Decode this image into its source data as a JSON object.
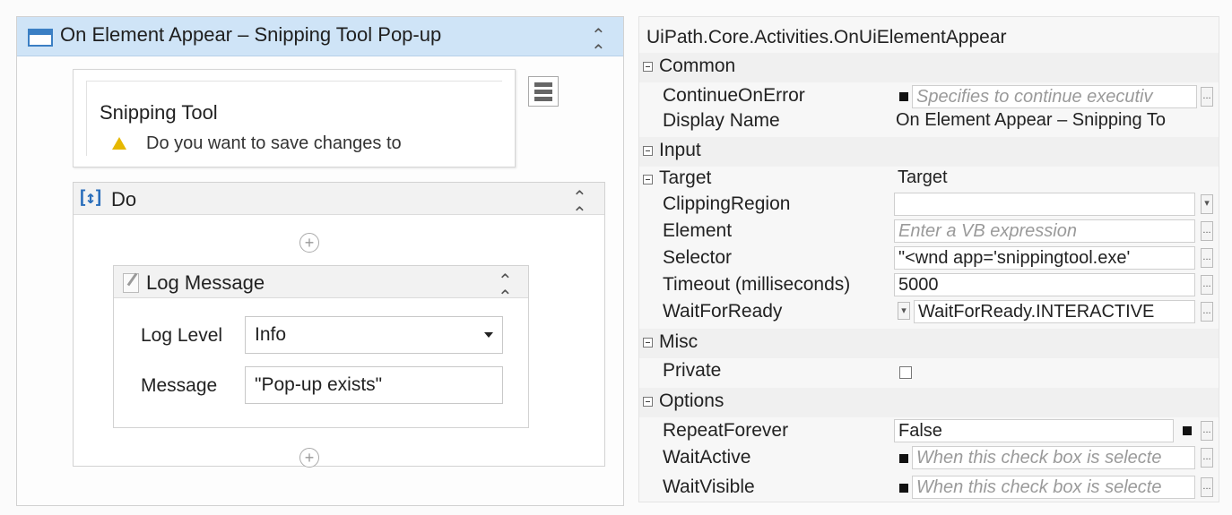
{
  "designer": {
    "activity_title": "On Element Appear – Snipping Tool Pop-up",
    "target_preview": {
      "title": "Snipping Tool",
      "clipped_text": "Do you want to save changes to"
    },
    "do_label": "Do",
    "log_message": {
      "title": "Log Message",
      "level_label": "Log Level",
      "level_value": "Info",
      "message_label": "Message",
      "message_value": "\"Pop-up exists\""
    }
  },
  "properties": {
    "title": "UiPath.Core.Activities.OnUiElementAppear",
    "categories": {
      "common": "Common",
      "input": "Input",
      "misc": "Misc",
      "options": "Options"
    },
    "continue_on_error": {
      "name": "ContinueOnError",
      "placeholder": "Specifies to continue executiv"
    },
    "display_name": {
      "name": "Display Name",
      "value": "On Element Appear – Snipping To"
    },
    "target": {
      "name": "Target",
      "value": "Target"
    },
    "clipping_region": {
      "name": "ClippingRegion",
      "value": ""
    },
    "element": {
      "name": "Element",
      "placeholder": "Enter a VB expression"
    },
    "selector": {
      "name": "Selector",
      "value": "\"<wnd app='snippingtool.exe'"
    },
    "timeout": {
      "name": "Timeout (milliseconds)",
      "value": "5000"
    },
    "wait_for_ready": {
      "name": "WaitForReady",
      "value": "WaitForReady.INTERACTIVE"
    },
    "private": {
      "name": "Private"
    },
    "repeat_forever": {
      "name": "RepeatForever",
      "value": "False"
    },
    "wait_active": {
      "name": "WaitActive",
      "placeholder": "When this check box is selecte"
    },
    "wait_visible": {
      "name": "WaitVisible",
      "placeholder": "When this check box is selecte"
    }
  },
  "icons": {
    "ellipsis": "...",
    "collapse": "⌃",
    "plus": "+"
  },
  "colors": {
    "header_blue": "#cfe4f7",
    "accent_blue": "#3b7fc4"
  }
}
